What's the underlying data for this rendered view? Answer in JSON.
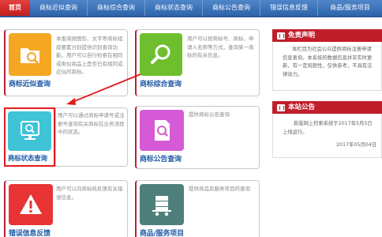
{
  "nav": {
    "items": [
      {
        "label": "首页",
        "active": true
      },
      {
        "label": "商标近似查询"
      },
      {
        "label": "商标综合查询"
      },
      {
        "label": "商标状态查询"
      },
      {
        "label": "商标公告查询"
      },
      {
        "label": "错误信息反馈"
      },
      {
        "label": "商品/服务项目"
      }
    ]
  },
  "cards": [
    {
      "title": "商标近似查询",
      "desc": "本查询按图形、文字等商标组成要素分别提供识别查询功能，用户可以自行检索在相同或类似商品上是否已有相同或近似的商标。",
      "icon": "folder-search-icon",
      "color": "#f5a623"
    },
    {
      "title": "商标综合查询",
      "desc": "用户可以按商标号、商标、申请人名称等方式，查询某一商标的有关信息。",
      "icon": "magnifier-icon",
      "color": "#6fbe2e"
    },
    {
      "title": "商标状态查询",
      "desc": "用户可以通过商标申请号或注册号查询有关商标在业务流程中的状态。",
      "icon": "monitor-search-icon",
      "color": "#3ec4d6"
    },
    {
      "title": "商标公告查询",
      "desc": "提供商标公告查询",
      "icon": "document-search-icon",
      "color": "#d65ad6"
    },
    {
      "title": "错误信息反馈",
      "desc": "用户可以向商标局反馈有关错误信息。",
      "icon": "warning-icon",
      "color": "#e83434"
    },
    {
      "title": "商品/服务项目",
      "desc": "提供商品及服务项目的查询",
      "icon": "cart-icon",
      "color": "#4f7f7a"
    }
  ],
  "sidebar": {
    "disclaimer": {
      "title": "免责声明",
      "text": "本栏目为社会公众提供商标注册申请信息查询，本系统的数据信息并非实时更新，有一定局限性，仅供参考，不具有法律效力。"
    },
    "notice": {
      "title": "本站公告",
      "text": "新版网上检索系统于2017年5月5日上线运行。",
      "date": "2017年05月04日"
    }
  },
  "colors": {
    "nav_blue": "#3a70b5",
    "nav_active": "#d42a2a",
    "title_blue": "#1f5aa6",
    "panel_red": "#c01e2a",
    "highlight_red": "#e21b1b"
  }
}
